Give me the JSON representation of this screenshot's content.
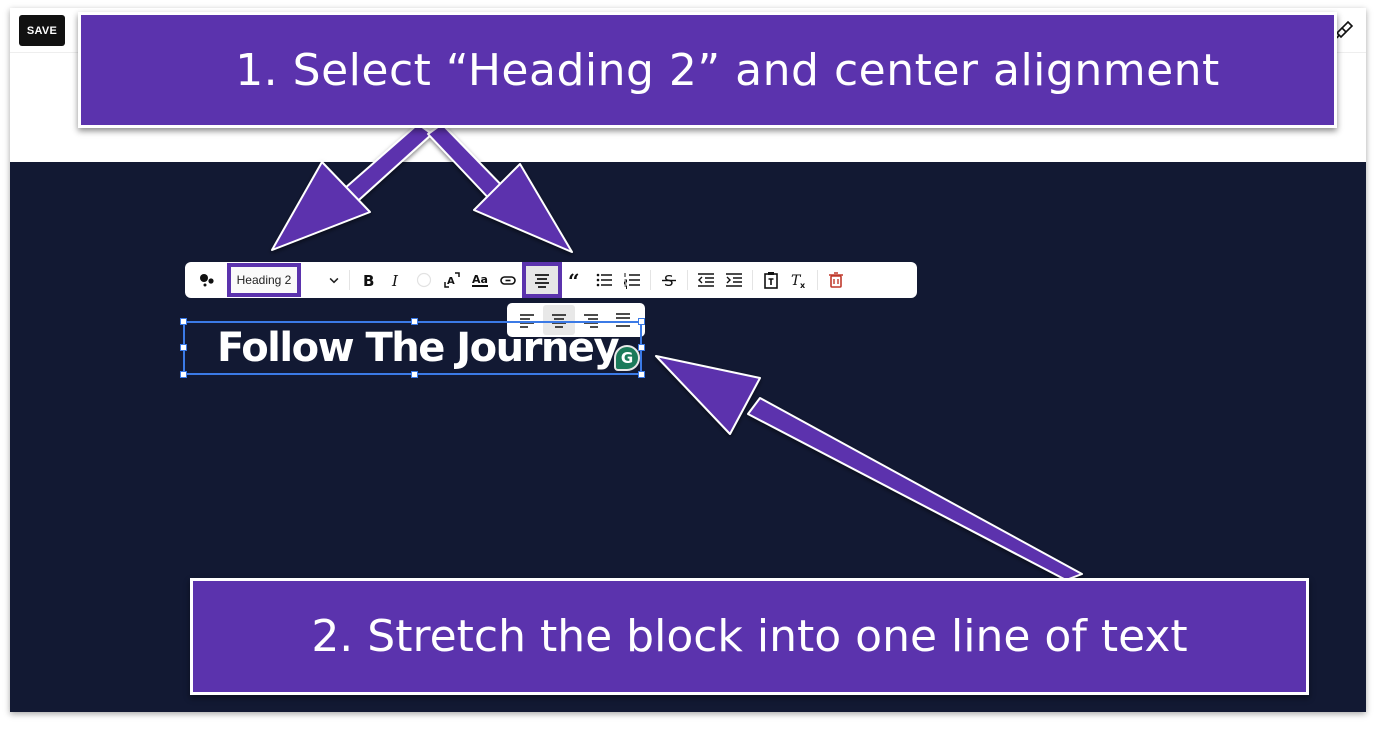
{
  "topbar": {
    "save_label": "SAVE",
    "design_icon": "paintbrush-icon"
  },
  "toolbar": {
    "items": [
      {
        "name": "block-menu",
        "icon": "dots-icon"
      },
      {
        "name": "text-style-select",
        "value": "Heading 2"
      },
      {
        "name": "style-dropdown-chevron",
        "icon": "chevron-down-icon"
      },
      {
        "name": "bold",
        "icon": "bold-icon"
      },
      {
        "name": "italic",
        "icon": "italic-icon"
      },
      {
        "name": "text-color",
        "icon": "color-circle-icon"
      },
      {
        "name": "font-size",
        "icon": "font-size-icon"
      },
      {
        "name": "font-style",
        "icon": "font-style-icon"
      },
      {
        "name": "link",
        "icon": "link-icon"
      },
      {
        "name": "align-center",
        "icon": "align-center-icon",
        "highlighted": true
      },
      {
        "name": "quote",
        "icon": "quote-icon"
      },
      {
        "name": "bulleted-list",
        "icon": "bullet-list-icon"
      },
      {
        "name": "numbered-list",
        "icon": "numbered-list-icon"
      },
      {
        "name": "strikethrough",
        "icon": "strikethrough-icon"
      },
      {
        "name": "outdent",
        "icon": "outdent-icon"
      },
      {
        "name": "indent",
        "icon": "indent-icon"
      },
      {
        "name": "paste-text",
        "icon": "clipboard-text-icon"
      },
      {
        "name": "clear-formatting",
        "icon": "clear-format-icon"
      },
      {
        "name": "delete",
        "icon": "trash-icon",
        "color": "#c0392b"
      }
    ]
  },
  "alignment_popup": {
    "options": [
      "align-left",
      "align-center",
      "align-right",
      "align-justify"
    ],
    "active": "align-center"
  },
  "text_block": {
    "content": "Follow The Journey",
    "grammarly_label": "G"
  },
  "callouts": {
    "step1": "1.  Select “Heading 2” and center alignment",
    "step2": "2. Stretch the block into one line of text"
  },
  "colors": {
    "callout_purple": "#5b33ad",
    "canvas_navy": "#121933",
    "selection_blue": "#3b7ae6"
  }
}
